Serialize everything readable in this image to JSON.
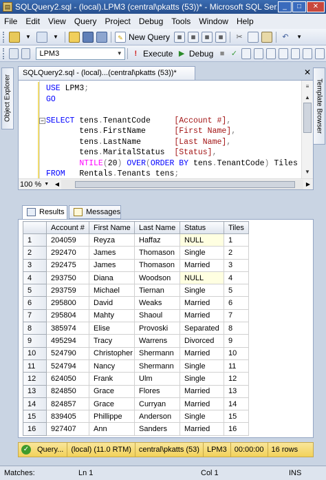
{
  "window": {
    "title": "SQLQuery2.sql - (local).LPM3 (central\\pkatts (53))* - Microsoft SQL Ser...",
    "min": "_",
    "max": "□",
    "close": "✕"
  },
  "menu": [
    "File",
    "Edit",
    "View",
    "Query",
    "Project",
    "Debug",
    "Tools",
    "Window",
    "Help"
  ],
  "toolbar1": {
    "new_query": "New Query"
  },
  "toolbar2": {
    "database": "LPM3",
    "execute": "Execute",
    "debug": "Debug"
  },
  "side": {
    "left": "Object Explorer",
    "right": "Template Browser"
  },
  "doc_tab": "SQLQuery2.sql - (local)...(central\\pkatts (53))*",
  "editor": {
    "zoom": "100 %"
  },
  "results_tabs": {
    "results": "Results",
    "messages": "Messages"
  },
  "grid": {
    "columns": [
      "Account #",
      "First Name",
      "Last Name",
      "Status",
      "Tiles"
    ],
    "rows": [
      [
        "1",
        "204059",
        "Reyza",
        "Haffaz",
        "NULL",
        "1"
      ],
      [
        "2",
        "292470",
        "James",
        "Thomason",
        "Single",
        "2"
      ],
      [
        "3",
        "292475",
        "James",
        "Thomason",
        "Married",
        "3"
      ],
      [
        "4",
        "293750",
        "Diana",
        "Woodson",
        "NULL",
        "4"
      ],
      [
        "5",
        "293759",
        "Michael",
        "Tiernan",
        "Single",
        "5"
      ],
      [
        "6",
        "295800",
        "David",
        "Weaks",
        "Married",
        "6"
      ],
      [
        "7",
        "295804",
        "Mahty",
        "Shaoul",
        "Married",
        "7"
      ],
      [
        "8",
        "385974",
        "Elise",
        "Provoski",
        "Separated",
        "8"
      ],
      [
        "9",
        "495294",
        "Tracy",
        "Warrens",
        "Divorced",
        "9"
      ],
      [
        "10",
        "524790",
        "Christopher",
        "Shermann",
        "Married",
        "10"
      ],
      [
        "11",
        "524794",
        "Nancy",
        "Shermann",
        "Single",
        "11"
      ],
      [
        "12",
        "624050",
        "Frank",
        "Ulm",
        "Single",
        "12"
      ],
      [
        "13",
        "824850",
        "Grace",
        "Flores",
        "Married",
        "13"
      ],
      [
        "14",
        "824857",
        "Grace",
        "Curryan",
        "Married",
        "14"
      ],
      [
        "15",
        "839405",
        "Phillippe",
        "Anderson",
        "Single",
        "15"
      ],
      [
        "16",
        "927407",
        "Ann",
        "Sanders",
        "Married",
        "16"
      ]
    ]
  },
  "status": {
    "query": "Query...",
    "server": "(local) (11.0 RTM)",
    "user": "central\\pkatts (53)",
    "db": "LPM3",
    "time": "00:00:00",
    "rows": "16 rows"
  },
  "bottom": {
    "matches": "Matches:",
    "ln": "Ln 1",
    "col": "Col 1",
    "ins": "INS"
  }
}
